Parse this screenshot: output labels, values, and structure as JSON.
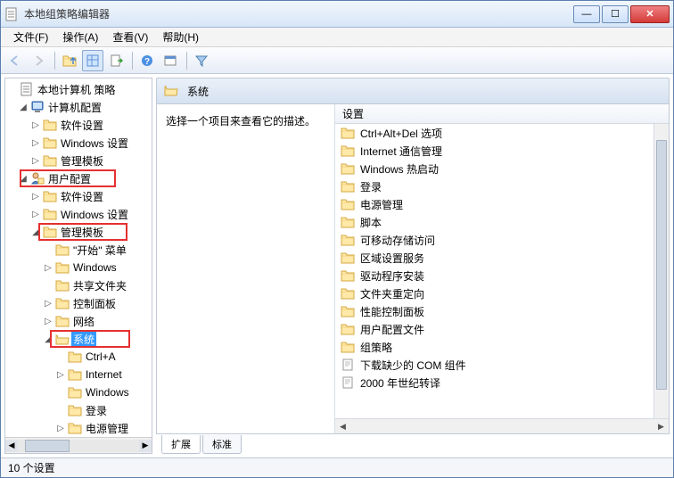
{
  "title": "本地组策略编辑器",
  "menu": {
    "file": "文件(F)",
    "action": "操作(A)",
    "view": "查看(V)",
    "help": "帮助(H)"
  },
  "tree": {
    "root": "本地计算机 策略",
    "computer": "计算机配置",
    "sw1": "软件设置",
    "win1": "Windows 设置",
    "admin1": "管理模板",
    "user": "用户配置",
    "sw2": "软件设置",
    "win2": "Windows 设置",
    "admin2": "管理模板",
    "start": "\"开始\" 菜单",
    "windows": "Windows",
    "share": "共享文件夹",
    "control": "控制面板",
    "network": "网络",
    "system": "系统",
    "ctrla": "Ctrl+A",
    "intern": "Internet",
    "winb": "Windows",
    "login": "登录",
    "power": "电源管理"
  },
  "header": {
    "title": "系统"
  },
  "desc": "选择一个项目来查看它的描述。",
  "list_header": "设置",
  "list": {
    "i0": "Ctrl+Alt+Del 选项",
    "i1": "Internet 通信管理",
    "i2": "Windows 热启动",
    "i3": "登录",
    "i4": "电源管理",
    "i5": "脚本",
    "i6": "可移动存储访问",
    "i7": "区域设置服务",
    "i8": "驱动程序安装",
    "i9": "文件夹重定向",
    "i10": "性能控制面板",
    "i11": "用户配置文件",
    "i12": "组策略",
    "i13": "下载缺少的 COM 组件",
    "i14": "2000 年世纪转译"
  },
  "tabs": {
    "ext": "扩展",
    "std": "标准"
  },
  "status": "10 个设置"
}
